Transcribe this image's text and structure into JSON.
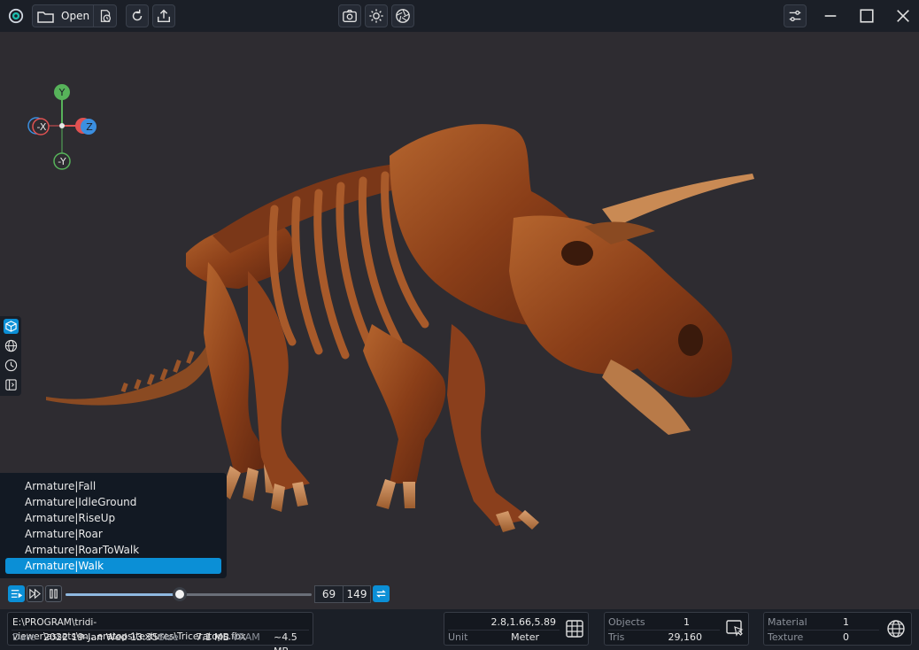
{
  "toolbar": {
    "open_label": "Open",
    "icons": [
      "app-logo-icon",
      "folder-icon",
      "recent-files-icon",
      "reset-view-icon",
      "export-icon",
      "screenshot-icon",
      "lighting-icon",
      "aperture-icon",
      "settings-icon",
      "minimize-icon",
      "maximize-icon",
      "close-icon"
    ]
  },
  "gizmo": {
    "y": "Y",
    "neg_y": "-Y",
    "neg_x": "-X",
    "z": "Z",
    "colors": {
      "y": "#57b35a",
      "x": "#e05252",
      "z": "#3b8fe0"
    }
  },
  "side_tools": [
    "cube-view-icon",
    "globe-icon",
    "clock-icon",
    "panel-icon"
  ],
  "animations": {
    "items": [
      "Armature|Fall",
      "Armature|IdleGround",
      "Armature|RiseUp",
      "Armature|Roar",
      "Armature|RoarToWalk",
      "Armature|Walk"
    ],
    "selected_index": 5
  },
  "timeline": {
    "current_frame": "69",
    "total_frames": "149",
    "progress": 0.463
  },
  "status": {
    "file_path": "E:\\PROGRAM\\tridi-viewer\\assets\\m...eratops\\textures\\Triceratops.fbx",
    "date_label": "Date",
    "date_value": "2022 19-Jan Wed 13:35",
    "size_label": "Size",
    "size_value": "7.1 MB",
    "vram_label": "VRAM",
    "vram_value": "~4.5 MB",
    "dimensions": "2.8,1.66,5.89",
    "unit_label": "Unit",
    "unit_value": "Meter",
    "objects_label": "Objects",
    "objects_value": "1",
    "tris_label": "Tris",
    "tris_value": "29,160",
    "material_label": "Material",
    "material_value": "1",
    "texture_label": "Texture",
    "texture_value": "0"
  },
  "colors": {
    "accent": "#0b8fd6",
    "background": "#2e2c31",
    "toolbar": "#1b1f27"
  }
}
